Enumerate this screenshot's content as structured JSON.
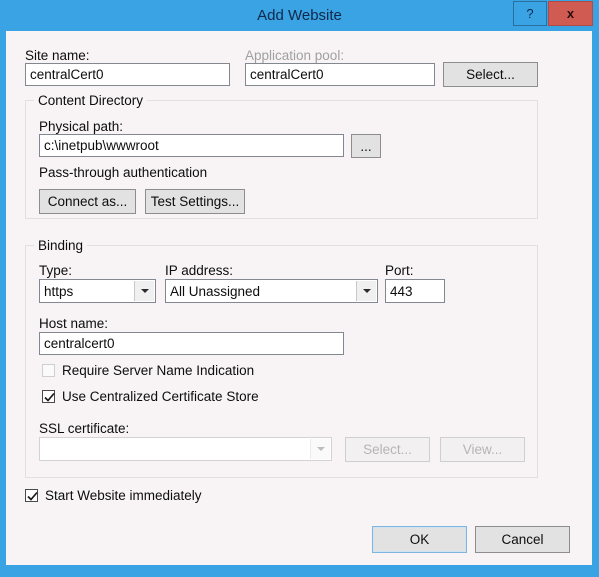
{
  "window": {
    "title": "Add Website",
    "help_label": "?",
    "close_label": "x",
    "accent_color": "#3aa3e3",
    "close_color": "#d05b53",
    "client_bg": "#f8f4f6"
  },
  "site": {
    "site_name_label": "Site name:",
    "site_name_value": "centralCert0",
    "app_pool_label": "Application pool:",
    "app_pool_value": "centralCert0",
    "select_label": "Select..."
  },
  "content_directory": {
    "group_title": "Content Directory",
    "physical_path_label": "Physical path:",
    "physical_path_value": "c:\\inetpub\\wwwroot",
    "browse_label": "...",
    "passthrough_label": "Pass-through authentication",
    "connect_as_label": "Connect as...",
    "test_settings_label": "Test Settings..."
  },
  "binding": {
    "group_title": "Binding",
    "type_label": "Type:",
    "type_value": "https",
    "ip_label": "IP address:",
    "ip_value": "All Unassigned",
    "port_label": "Port:",
    "port_value": "443",
    "host_label": "Host name:",
    "host_value": "centralcert0",
    "sni_label": "Require Server Name Indication",
    "ccs_label": "Use Centralized Certificate Store",
    "ssl_label": "SSL certificate:",
    "ssl_value": "",
    "ssl_select_label": "Select...",
    "ssl_view_label": "View..."
  },
  "footer": {
    "start_website_label": "Start Website immediately",
    "ok_label": "OK",
    "cancel_label": "Cancel"
  }
}
